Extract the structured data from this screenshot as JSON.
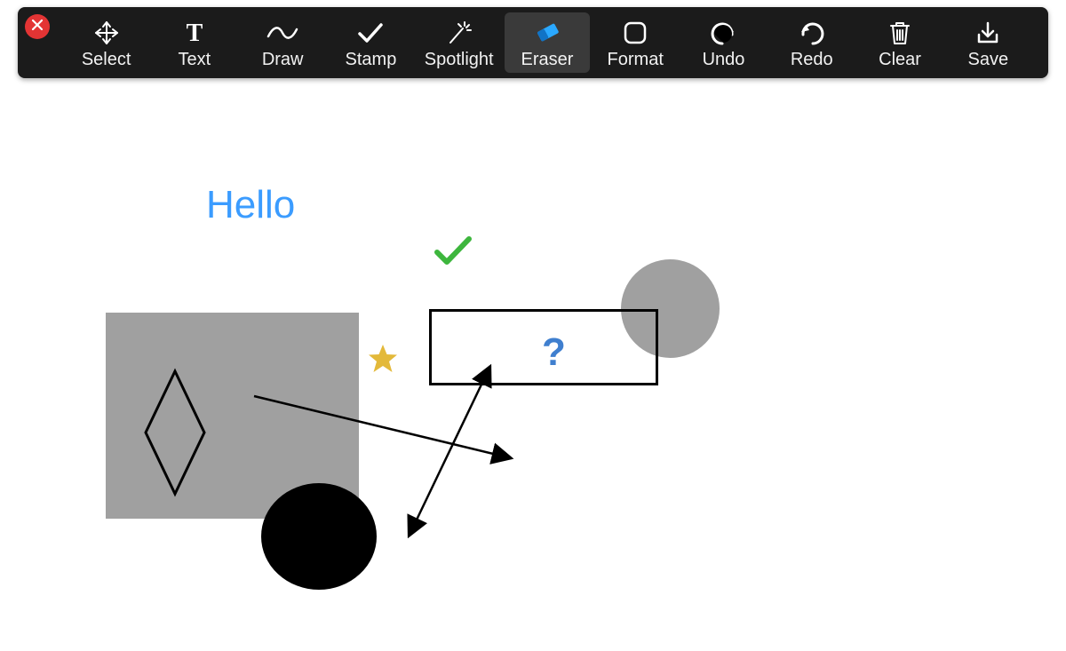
{
  "toolbar": {
    "tools": [
      {
        "id": "select",
        "label": "Select",
        "active": false
      },
      {
        "id": "text",
        "label": "Text",
        "active": false
      },
      {
        "id": "draw",
        "label": "Draw",
        "active": false
      },
      {
        "id": "stamp",
        "label": "Stamp",
        "active": false
      },
      {
        "id": "spotlight",
        "label": "Spotlight",
        "active": false
      },
      {
        "id": "eraser",
        "label": "Eraser",
        "active": true
      },
      {
        "id": "format",
        "label": "Format",
        "active": false
      },
      {
        "id": "undo",
        "label": "Undo",
        "active": false
      },
      {
        "id": "redo",
        "label": "Redo",
        "active": false
      },
      {
        "id": "clear",
        "label": "Clear",
        "active": false
      },
      {
        "id": "save",
        "label": "Save",
        "active": false
      }
    ]
  },
  "canvas": {
    "hello_text": "Hello",
    "question_mark": "?"
  },
  "colors": {
    "toolbar_bg": "#1b1b1b",
    "active_tool_bg": "#3a3a3a",
    "eraser_accent": "#2aa8ff",
    "hello_blue": "#3b9cff",
    "qmark_blue": "#3f7fcf",
    "gray_fill": "#a0a0a0",
    "star_gold": "#e3b93a",
    "check_green": "#3db63d"
  }
}
